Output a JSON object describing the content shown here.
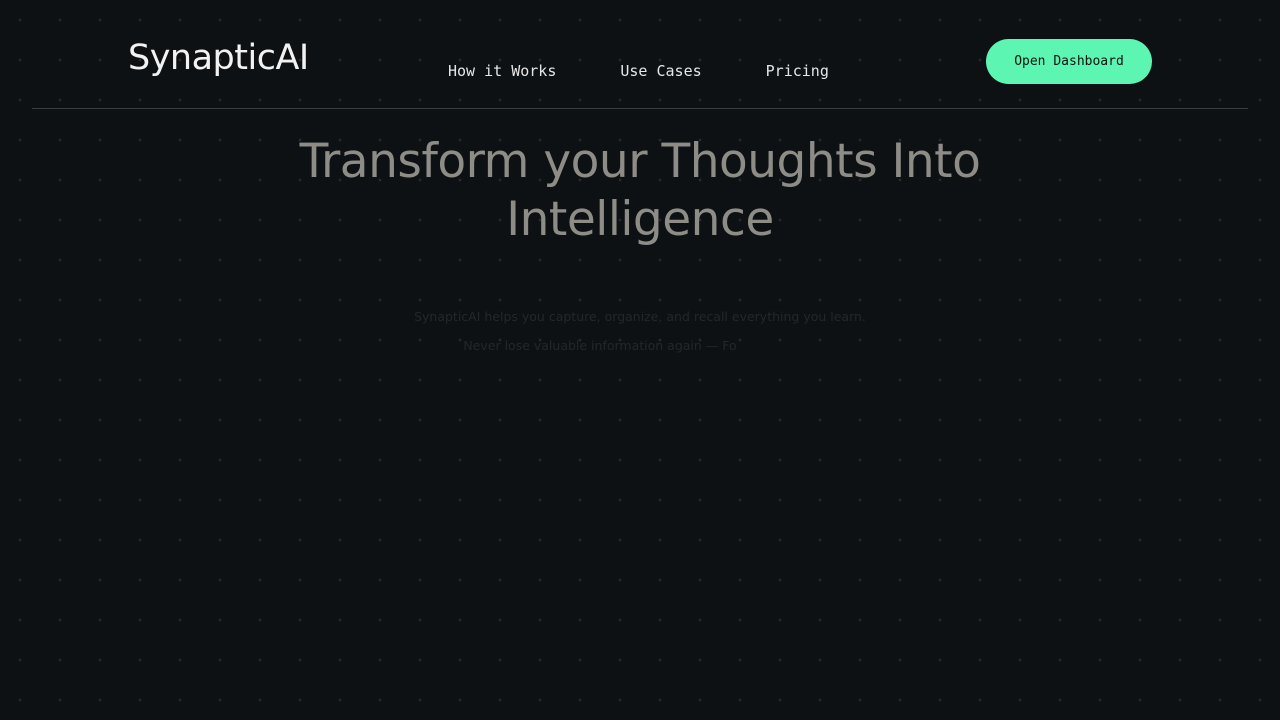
{
  "brand": {
    "name": "SynapticAI"
  },
  "nav": {
    "items": [
      {
        "label": "How it Works"
      },
      {
        "label": "Use Cases"
      },
      {
        "label": "Pricing"
      }
    ]
  },
  "header": {
    "cta_label": "Open Dashboard"
  },
  "hero": {
    "title_line1": "Transform your Thoughts Into",
    "title_line2": "Intelligence",
    "subtitle_line1": "SynapticAI helps you capture, organize, and recall everything you learn.",
    "subtitle_line2": "Never lose valuable information again — Fo"
  },
  "colors": {
    "background": "#0e1114",
    "accent": "#5df5b2",
    "title_text": "#8e8c87"
  }
}
